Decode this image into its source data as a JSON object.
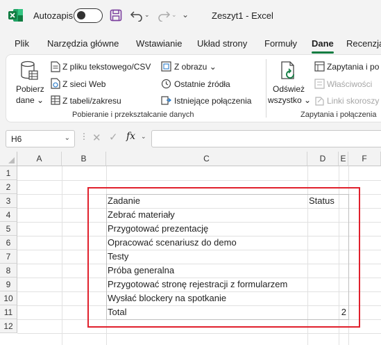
{
  "titlebar": {
    "autosave_label": "Autozapis",
    "document_title": "Zeszyt1  -  Excel"
  },
  "ribbon_tabs": [
    {
      "label": "Plik"
    },
    {
      "label": "Narzędzia główne"
    },
    {
      "label": "Wstawianie"
    },
    {
      "label": "Układ strony"
    },
    {
      "label": "Formuły"
    },
    {
      "label": "Dane",
      "active": true
    },
    {
      "label": "Recenzja"
    }
  ],
  "ribbon": {
    "get_data": {
      "line1": "Pobierz",
      "line2": "dane ⌄"
    },
    "from_text_csv": "Z pliku tekstowego/CSV",
    "from_web": "Z sieci Web",
    "from_table": "Z tabeli/zakresu",
    "from_picture": "Z obrazu ⌄",
    "recent_sources": "Ostatnie źródła",
    "existing_connections": "Istniejące połączenia",
    "group1_label": "Pobieranie i przekształcanie danych",
    "refresh_all": {
      "line1": "Odśwież",
      "line2": "wszystko ⌄"
    },
    "queries_connections": "Zapytania i po",
    "properties": "Właściwości",
    "edit_links": "Linki skoroszy",
    "group2_label": "Zapytania i połączenia"
  },
  "formula_bar": {
    "name_box": "H6",
    "formula": ""
  },
  "grid": {
    "columns": [
      "A",
      "B",
      "C",
      "D",
      "E",
      "F"
    ],
    "rows": [
      "1",
      "2",
      "3",
      "4",
      "5",
      "6",
      "7",
      "8",
      "9",
      "10",
      "11",
      "12"
    ],
    "active_cell": "H6",
    "cells": {
      "C3": "Zadanie",
      "D3": "Status",
      "C4": "Zebrać materiały",
      "C5": "Przygotować prezentację",
      "C6": "Opracować scenariusz do demo",
      "C7": "Testy",
      "C8": "Próba generalna",
      "C9": "Przygotować stronę rejestracji z formularzem",
      "C10": "Wysłać blockery na spotkanie",
      "C11": "Total",
      "E11": "2"
    }
  },
  "colors": {
    "accent": "#107c41",
    "highlight_border": "#e0202c"
  }
}
